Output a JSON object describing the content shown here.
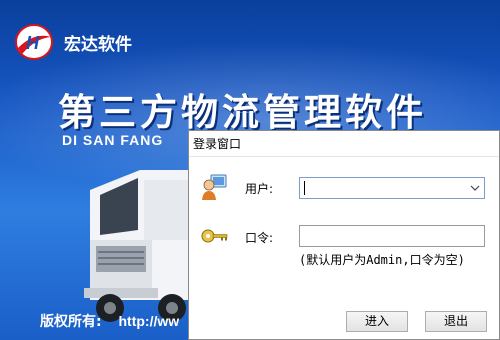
{
  "splash": {
    "brand": "宏达软件",
    "logo_text": "H",
    "main_title": "第三方物流管理软件",
    "pinyin": "DI SAN FANG",
    "copyright_label": "版权所有:",
    "copyright_url": "http://ww"
  },
  "dialog": {
    "title": "登录窗口",
    "user_label": "用户:",
    "user_value": "",
    "password_label": "口令:",
    "password_value": "",
    "hint": "(默认用户为Admin,口令为空)",
    "enter_button": "进入",
    "exit_button": "退出"
  },
  "colors": {
    "splash_blue": "#1757c4",
    "logo_red": "#d8141c",
    "combo_border": "#7a9cc6"
  }
}
